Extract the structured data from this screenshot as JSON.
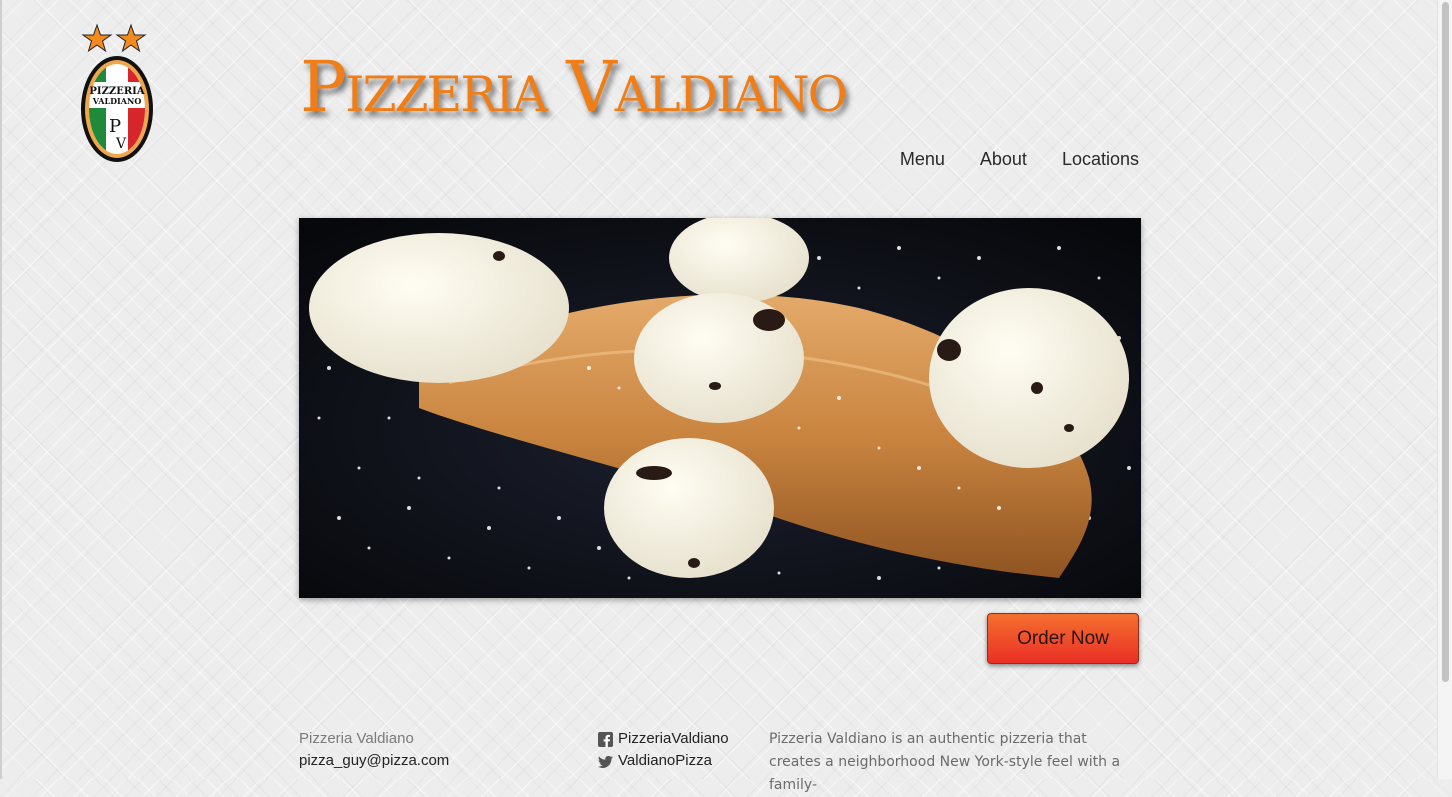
{
  "brand": {
    "name": "Pizzeria Valdiano"
  },
  "logo": {
    "line1": "PIZZERIA",
    "line2": "VALDIANO",
    "monogram_p": "P",
    "monogram_v": "V"
  },
  "nav": {
    "items": [
      "Menu",
      "About",
      "Locations"
    ]
  },
  "hero": {
    "alt_subject": "cannoli-photo"
  },
  "cta": {
    "order_label": "Order Now"
  },
  "footer": {
    "name": "Pizzeria Valdiano",
    "email": "pizza_guy@pizza.com",
    "facebook": "PizzeriaValdiano",
    "twitter": "ValdianoPizza",
    "about": "Pizzeria Valdiano is an authentic pizzeria that creates a neighborhood New York-style feel with a family-"
  },
  "colors": {
    "brand_orange": "#f07d16",
    "button_top": "#f4702e",
    "button_bottom": "#ea2f26",
    "italy_green": "#1f8a3a",
    "italy_red": "#d7262b"
  },
  "icons": [
    "star-icon",
    "facebook-icon",
    "twitter-icon"
  ]
}
